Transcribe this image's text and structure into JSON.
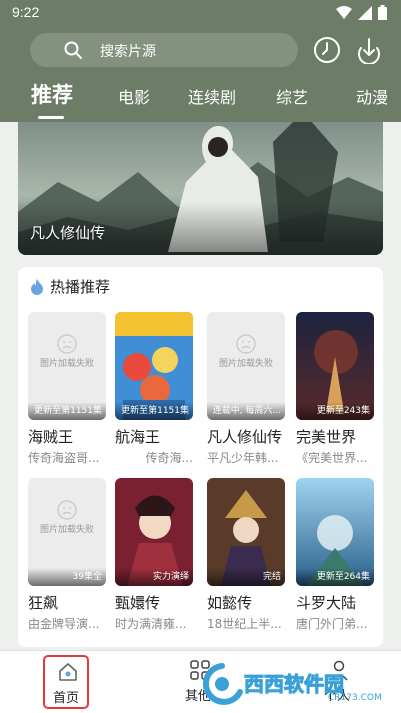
{
  "status": {
    "time": "9:22"
  },
  "search": {
    "placeholder": "搜索片源"
  },
  "tabs": [
    {
      "label": "推荐",
      "active": true
    },
    {
      "label": "电影"
    },
    {
      "label": "连续剧"
    },
    {
      "label": "综艺"
    },
    {
      "label": "动漫"
    }
  ],
  "banner": {
    "title": "凡人修仙传"
  },
  "hot": {
    "title": "热播推荐",
    "items": [
      {
        "name": "海贼王",
        "desc": "传奇海盗哥...",
        "badge": "更新至第1151集",
        "image_failed": true,
        "fail_text": "图片加载失败"
      },
      {
        "name": "航海王",
        "desc": "传奇海...",
        "badge": "更新至第1151集",
        "image_failed": false
      },
      {
        "name": "凡人修仙传",
        "desc": "平凡少年韩...",
        "badge": "连载中, 每周六...",
        "image_failed": true,
        "fail_text": "图片加载失败"
      },
      {
        "name": "完美世界",
        "desc": "《完美世界...",
        "badge": "更新至243集",
        "image_failed": false
      },
      {
        "name": "狂飙",
        "desc": "由金牌导演...",
        "badge": "39集全",
        "image_failed": true,
        "fail_text": "图片加载失败"
      },
      {
        "name": "甄嬛传",
        "desc": "时为满清雍...",
        "badge": "实力演绎",
        "image_failed": false
      },
      {
        "name": "如懿传",
        "desc": "18世纪上半...",
        "badge": "完结",
        "image_failed": false
      },
      {
        "name": "斗罗大陆",
        "desc": "唐门外门弟...",
        "badge": "更新至264集",
        "image_failed": false
      }
    ]
  },
  "nav": {
    "home": "首页",
    "other": "其他",
    "mine": "个人"
  },
  "watermark": {
    "text": "西西软件园",
    "url": "CR173.COM"
  },
  "colors": {
    "header": "#6d7c66",
    "accent": "#e53935"
  }
}
